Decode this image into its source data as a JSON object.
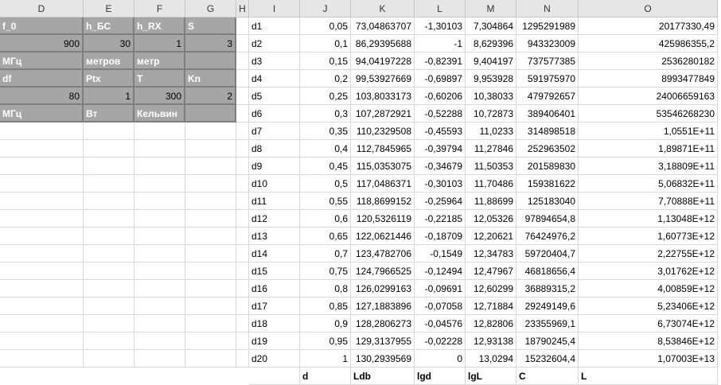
{
  "columns": [
    {
      "letter": "D",
      "w": 105
    },
    {
      "letter": "E",
      "w": 64
    },
    {
      "letter": "F",
      "w": 64
    },
    {
      "letter": "G",
      "w": 64
    },
    {
      "letter": "H",
      "w": 16
    },
    {
      "letter": "I",
      "w": 64
    },
    {
      "letter": "J",
      "w": 64
    },
    {
      "letter": "K",
      "w": 80
    },
    {
      "letter": "L",
      "w": 64
    },
    {
      "letter": "M",
      "w": 64
    },
    {
      "letter": "N",
      "w": 78
    },
    {
      "letter": "O",
      "w": 175
    }
  ],
  "params": {
    "rows": [
      [
        "f_0",
        "h_БС",
        "h_RX",
        "S"
      ],
      [
        "900",
        "30",
        "1",
        "3"
      ],
      [
        "МГц",
        "метров",
        "метр",
        ""
      ],
      [
        "df",
        "Ptx",
        "T",
        "Kn"
      ],
      [
        "80",
        "1",
        "300",
        "2"
      ],
      [
        "МГц",
        "Вт",
        "Кельвин",
        ""
      ]
    ]
  },
  "table": {
    "rows": [
      [
        "d1",
        "0,05",
        "73,04863707",
        "-1,30103",
        "7,304864",
        "1295291989",
        "20177330,49"
      ],
      [
        "d2",
        "0,1",
        "86,29395688",
        "-1",
        "8,629396",
        "943323009",
        "425986355,2"
      ],
      [
        "d3",
        "0,15",
        "94,04197228",
        "-0,82391",
        "9,404197",
        "737577385",
        "2536280182"
      ],
      [
        "d4",
        "0,2",
        "99,53927669",
        "-0,69897",
        "9,953928",
        "591975970",
        "8993477849"
      ],
      [
        "d5",
        "0,25",
        "103,8033173",
        "-0,60206",
        "10,38033",
        "479792657",
        "24006659163"
      ],
      [
        "d6",
        "0,3",
        "107,2872921",
        "-0,52288",
        "10,72873",
        "389406401",
        "53546268230"
      ],
      [
        "d7",
        "0,35",
        "110,2329508",
        "-0,45593",
        "11,0233",
        "314898518",
        "1,0551E+11"
      ],
      [
        "d8",
        "0,4",
        "112,7845965",
        "-0,39794",
        "11,27846",
        "252963502",
        "1,89871E+11"
      ],
      [
        "d9",
        "0,45",
        "115,0353075",
        "-0,34679",
        "11,50353",
        "201589830",
        "3,18809E+11"
      ],
      [
        "d10",
        "0,5",
        "117,0486371",
        "-0,30103",
        "11,70486",
        "159381622",
        "5,06832E+11"
      ],
      [
        "d11",
        "0,55",
        "118,8699152",
        "-0,25964",
        "11,88699",
        "125183040",
        "7,70888E+11"
      ],
      [
        "d12",
        "0,6",
        "120,5326119",
        "-0,22185",
        "12,05326",
        "97894654,8",
        "1,13048E+12"
      ],
      [
        "d13",
        "0,65",
        "122,0621446",
        "-0,18709",
        "12,20621",
        "76424976,2",
        "1,60773E+12"
      ],
      [
        "d14",
        "0,7",
        "123,4782706",
        "-0,1549",
        "12,34783",
        "59720404,7",
        "2,22755E+12"
      ],
      [
        "d15",
        "0,75",
        "124,7966525",
        "-0,12494",
        "12,47967",
        "46818656,4",
        "3,01762E+12"
      ],
      [
        "d16",
        "0,8",
        "126,0299163",
        "-0,09691",
        "12,60299",
        "36889315,2",
        "4,00859E+12"
      ],
      [
        "d17",
        "0,85",
        "127,1883896",
        "-0,07058",
        "12,71884",
        "29249149,6",
        "5,23406E+12"
      ],
      [
        "d18",
        "0,9",
        "128,2806273",
        "-0,04576",
        "12,82806",
        "23355969,1",
        "6,73074E+12"
      ],
      [
        "d19",
        "0,95",
        "129,3137955",
        "-0,02228",
        "12,93138",
        "18790245,4",
        "8,53846E+12"
      ],
      [
        "d20",
        "1",
        "130,2939569",
        "0",
        "13,0294",
        "15232604,4",
        "1,07003E+13"
      ]
    ],
    "footer": [
      "",
      "d",
      "Ldb",
      "lgd",
      "lgL",
      "C",
      "L"
    ]
  }
}
